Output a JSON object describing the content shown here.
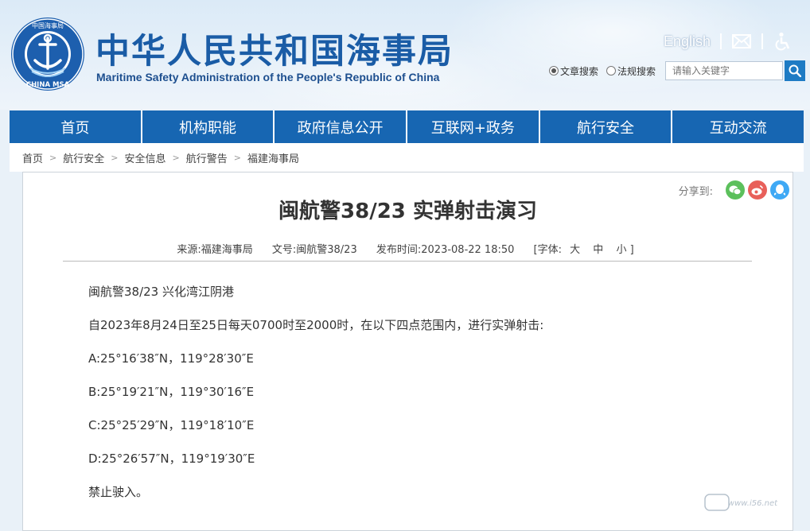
{
  "header": {
    "title_cn": "中华人民共和国海事局",
    "title_en": "Maritime Safety Administration of the People's Republic of China",
    "logo_text_top": "中国海事局",
    "logo_text_bottom": "CHINA MSA",
    "english_link": "English",
    "icons": [
      "mail-icon",
      "accessibility-icon",
      "search-icon"
    ]
  },
  "search": {
    "option_article": "文章搜索",
    "option_law": "法规搜索",
    "selected": "文章搜索",
    "placeholder": "请输入关键字"
  },
  "nav": {
    "items": [
      "首页",
      "机构职能",
      "政府信息公开",
      "互联网+政务",
      "航行安全",
      "互动交流"
    ]
  },
  "breadcrumb": [
    "首页",
    "航行安全",
    "安全信息",
    "航行警告",
    "福建海事局"
  ],
  "share": {
    "label": "分享到:",
    "icons": [
      "wechat-icon",
      "weibo-icon",
      "qq-icon"
    ],
    "colors": {
      "wechat": "#5cc05c",
      "weibo": "#e8605a",
      "qq": "#3fa9f5"
    }
  },
  "article": {
    "title": "闽航警38/23 实弹射击演习",
    "source_label": "来源:",
    "source": "福建海事局",
    "doc_label": "文号:",
    "doc_no": "闽航警38/23",
    "date_label": "发布时间:",
    "date": "2023-08-22 18:50",
    "font_label": "[字体:",
    "font_large": "大",
    "font_medium": "中",
    "font_small": "小 ]",
    "paragraphs": [
      "闽航警38/23  兴化湾江阴港",
      "自2023年8月24日至25日每天0700时至2000时，在以下四点范围内，进行实弹射击:",
      "A:25°16′38″N，119°28′30″E",
      "B:25°19′21″N，119°30′16″E",
      "C:25°25′29″N，119°18′10″E",
      "D:25°26′57″N，119°19′30″E",
      "禁止驶入。"
    ]
  },
  "watermark": {
    "text": "www.i56.net"
  },
  "colors": {
    "nav_bg": "#1766b2",
    "title_blue": "#1a5ca6",
    "search_btn": "#1e7bc4"
  }
}
